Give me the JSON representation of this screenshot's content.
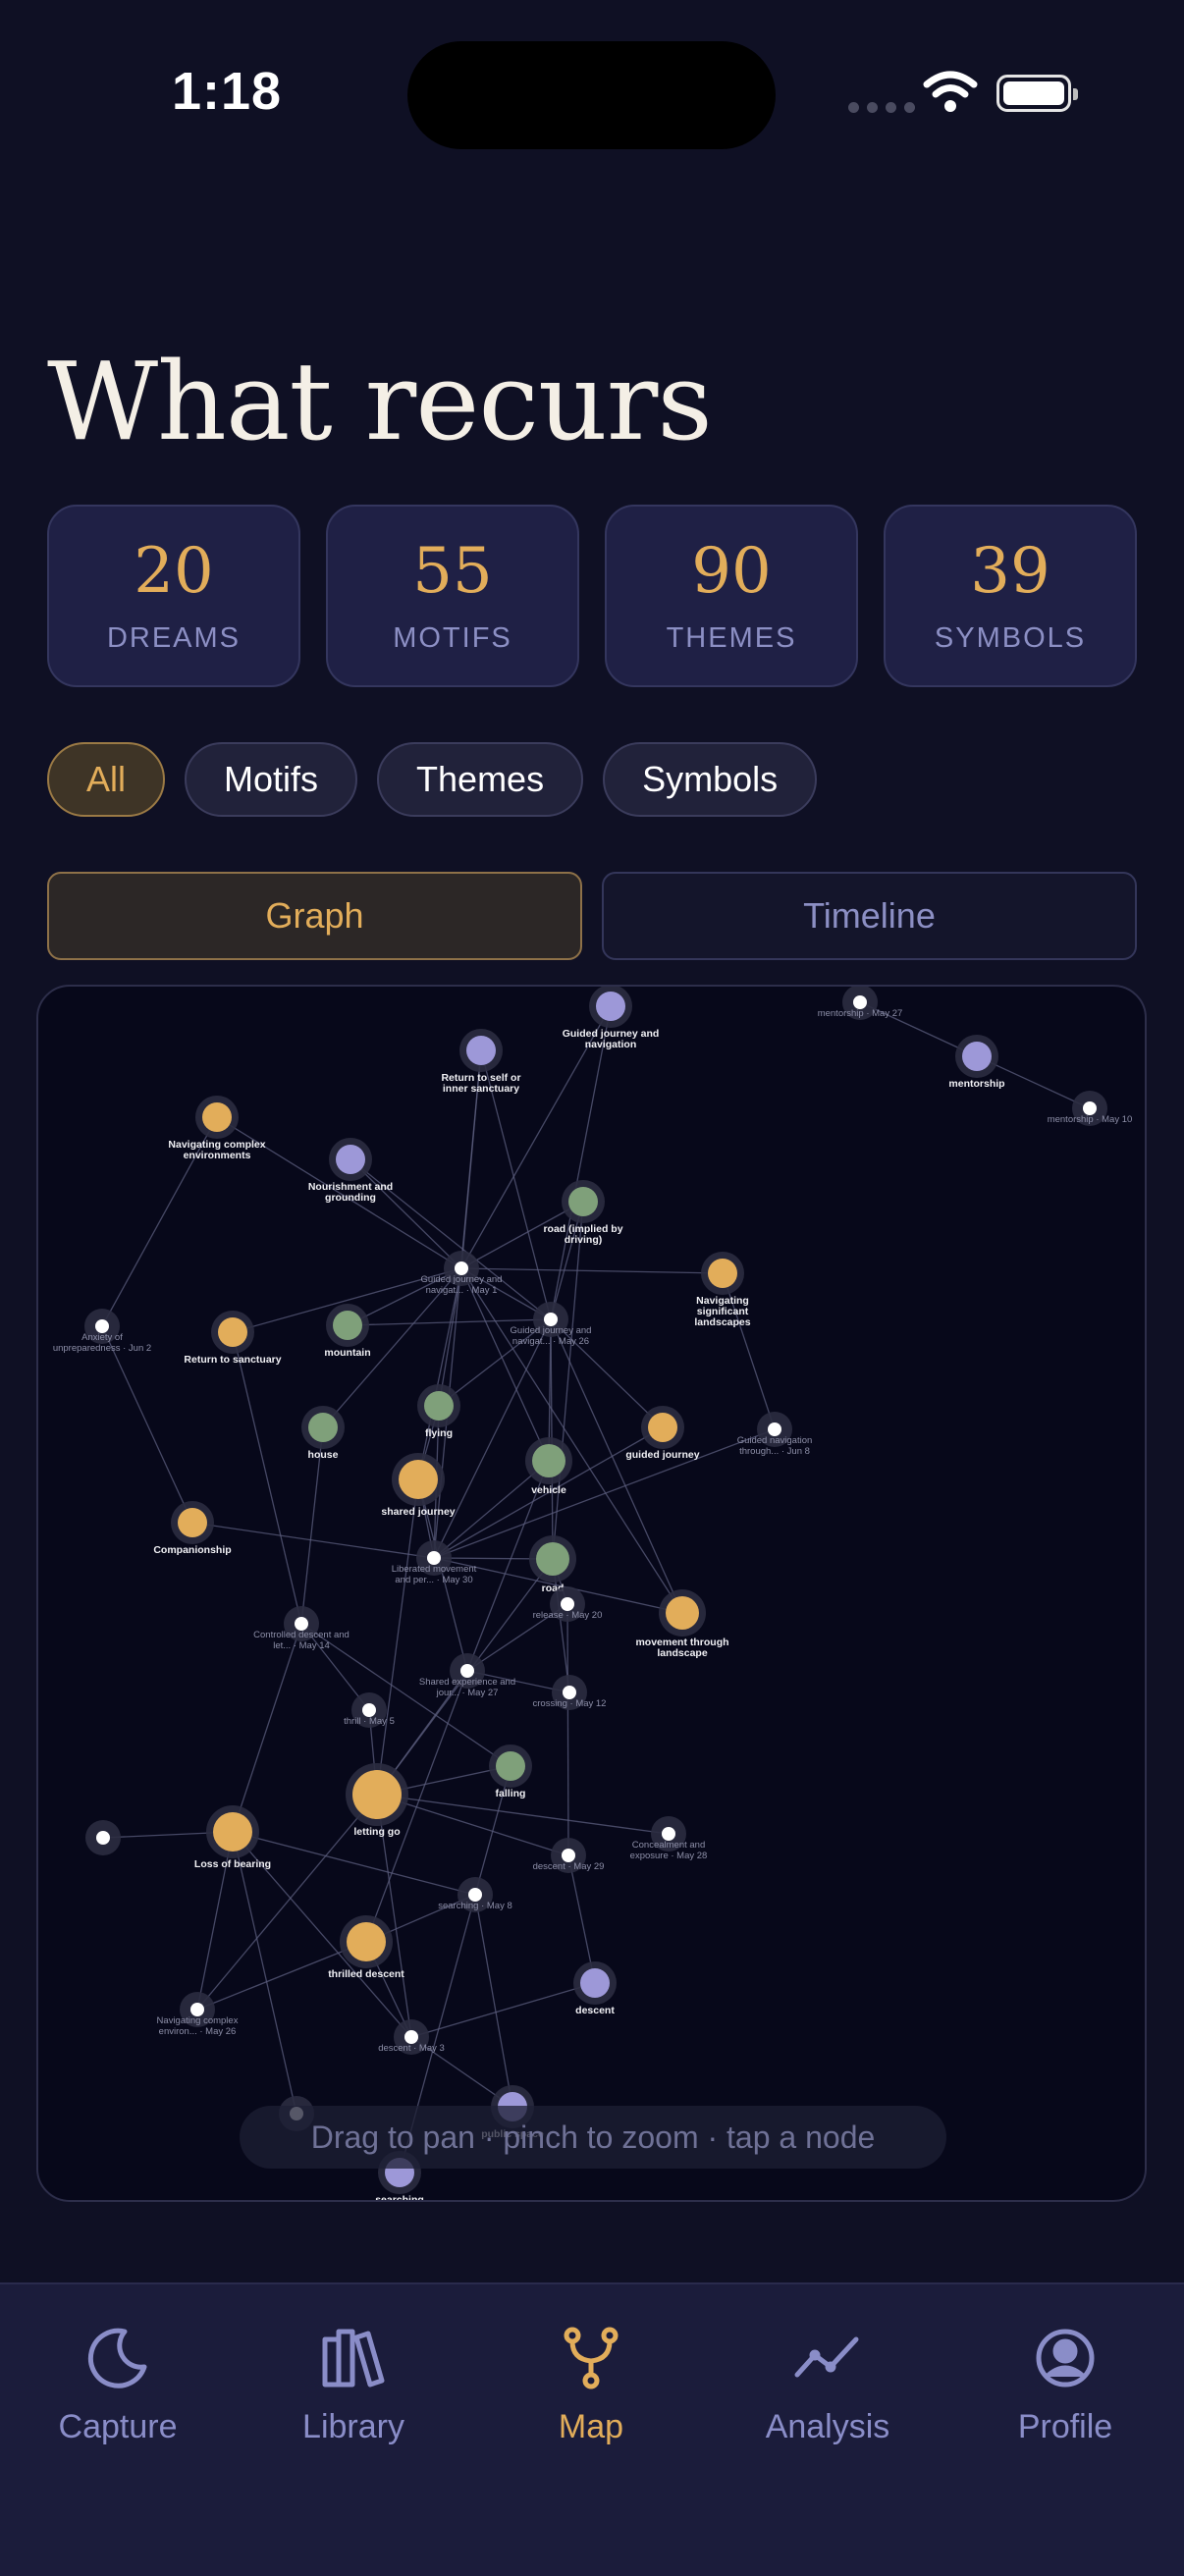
{
  "status": {
    "time": "1:18"
  },
  "page": {
    "title": "What recurs"
  },
  "stats": [
    {
      "value": "20",
      "label": "DREAMS"
    },
    {
      "value": "55",
      "label": "MOTIFS"
    },
    {
      "value": "90",
      "label": "THEMES"
    },
    {
      "value": "39",
      "label": "SYMBOLS"
    }
  ],
  "filters": [
    "All",
    "Motifs",
    "Themes",
    "Symbols"
  ],
  "view_toggle": {
    "graph": "Graph",
    "timeline": "Timeline"
  },
  "graph": {
    "hint": "Drag to pan · pinch to zoom · tap a node",
    "colors": {
      "motif": "#e2ad5a",
      "theme": "#7fa07a",
      "symbol": "#9d98d8",
      "dream": "#ffffff"
    },
    "nodes": [
      {
        "id": "n1",
        "type": "symbol",
        "label": [
          "Guided journey and",
          "navigation"
        ]
      },
      {
        "id": "n2",
        "type": "dream",
        "label": [
          "mentorship · May 27"
        ]
      },
      {
        "id": "n3",
        "type": "symbol",
        "label": [
          "Return to self or",
          "inner sanctuary"
        ]
      },
      {
        "id": "n4",
        "type": "symbol",
        "label": [
          "mentorship"
        ]
      },
      {
        "id": "n5",
        "type": "dream",
        "label": [
          "mentorship · May 10"
        ]
      },
      {
        "id": "n6",
        "type": "motif",
        "label": [
          "Navigating complex",
          "environments"
        ]
      },
      {
        "id": "n7",
        "type": "symbol",
        "label": [
          "Nourishment and",
          "grounding"
        ]
      },
      {
        "id": "n8",
        "type": "theme",
        "label": [
          "road (implied by",
          "driving)"
        ]
      },
      {
        "id": "n9",
        "type": "dream",
        "label": [
          "Guided journey and",
          "navigat... · May 1"
        ]
      },
      {
        "id": "n10",
        "type": "motif",
        "label": [
          "Navigating",
          "significant",
          "landscapes"
        ]
      },
      {
        "id": "n11",
        "type": "dream",
        "label": [
          "Anxiety of",
          "unpreparedness · Jun 2"
        ]
      },
      {
        "id": "n12",
        "type": "motif",
        "label": [
          "Return to sanctuary"
        ]
      },
      {
        "id": "n13",
        "type": "theme",
        "label": [
          "mountain"
        ]
      },
      {
        "id": "n14",
        "type": "dream",
        "label": [
          "Guided journey and",
          "navigat... · May 26"
        ]
      },
      {
        "id": "n15",
        "type": "theme",
        "label": [
          "flying"
        ]
      },
      {
        "id": "n16",
        "type": "theme",
        "label": [
          "house"
        ]
      },
      {
        "id": "n17",
        "type": "motif",
        "label": [
          "guided journey"
        ]
      },
      {
        "id": "n18",
        "type": "dream",
        "label": [
          "Guided navigation",
          "through... · Jun 8"
        ]
      },
      {
        "id": "n19",
        "type": "motif",
        "label": [
          "shared journey"
        ]
      },
      {
        "id": "n20",
        "type": "theme",
        "label": [
          "vehicle"
        ]
      },
      {
        "id": "n21",
        "type": "motif",
        "label": [
          "Companionship"
        ]
      },
      {
        "id": "n22",
        "type": "dream",
        "label": [
          "Liberated movement",
          "and per... · May 30"
        ]
      },
      {
        "id": "n23",
        "type": "theme",
        "label": [
          "road"
        ]
      },
      {
        "id": "n24",
        "type": "dream",
        "label": [
          "release · May 20"
        ]
      },
      {
        "id": "n25",
        "type": "motif",
        "label": [
          "movement through",
          "landscape"
        ]
      },
      {
        "id": "n26",
        "type": "dream",
        "label": [
          "Controlled descent and",
          "let... · May 14"
        ]
      },
      {
        "id": "n27",
        "type": "dream",
        "label": [
          "Shared experience and",
          "jour... · May 27"
        ]
      },
      {
        "id": "n28",
        "type": "dream",
        "label": [
          "crossing · May 12"
        ]
      },
      {
        "id": "n29",
        "type": "dream",
        "label": [
          "thrill · May 5"
        ]
      },
      {
        "id": "n30",
        "type": "theme",
        "label": [
          "falling"
        ]
      },
      {
        "id": "n31",
        "type": "motif",
        "label": [
          "letting go"
        ]
      },
      {
        "id": "n32",
        "type": "dream",
        "label": []
      },
      {
        "id": "n33",
        "type": "motif",
        "label": [
          "Loss of bearing"
        ]
      },
      {
        "id": "n34",
        "type": "dream",
        "label": [
          "Concealment and",
          "exposure · May 28"
        ]
      },
      {
        "id": "n35",
        "type": "dream",
        "label": [
          "descent · May 29"
        ]
      },
      {
        "id": "n36",
        "type": "dream",
        "label": [
          "searching · May 8"
        ]
      },
      {
        "id": "n37",
        "type": "motif",
        "label": [
          "thrilled descent"
        ]
      },
      {
        "id": "n38",
        "type": "symbol",
        "label": [
          "descent"
        ]
      },
      {
        "id": "n39",
        "type": "dream",
        "label": [
          "Navigating complex",
          "environ... · May 26"
        ]
      },
      {
        "id": "n40",
        "type": "dream",
        "label": [
          "descent · May 3"
        ]
      },
      {
        "id": "n41",
        "type": "dream",
        "label": []
      },
      {
        "id": "n42",
        "type": "symbol",
        "label": [
          "public space"
        ]
      },
      {
        "id": "n43",
        "type": "symbol",
        "label": [
          "searching"
        ]
      }
    ]
  },
  "tabs": [
    {
      "label": "Capture",
      "icon": "moon-icon"
    },
    {
      "label": "Library",
      "icon": "books-icon"
    },
    {
      "label": "Map",
      "icon": "branch-icon"
    },
    {
      "label": "Analysis",
      "icon": "trend-icon"
    },
    {
      "label": "Profile",
      "icon": "person-icon"
    }
  ]
}
